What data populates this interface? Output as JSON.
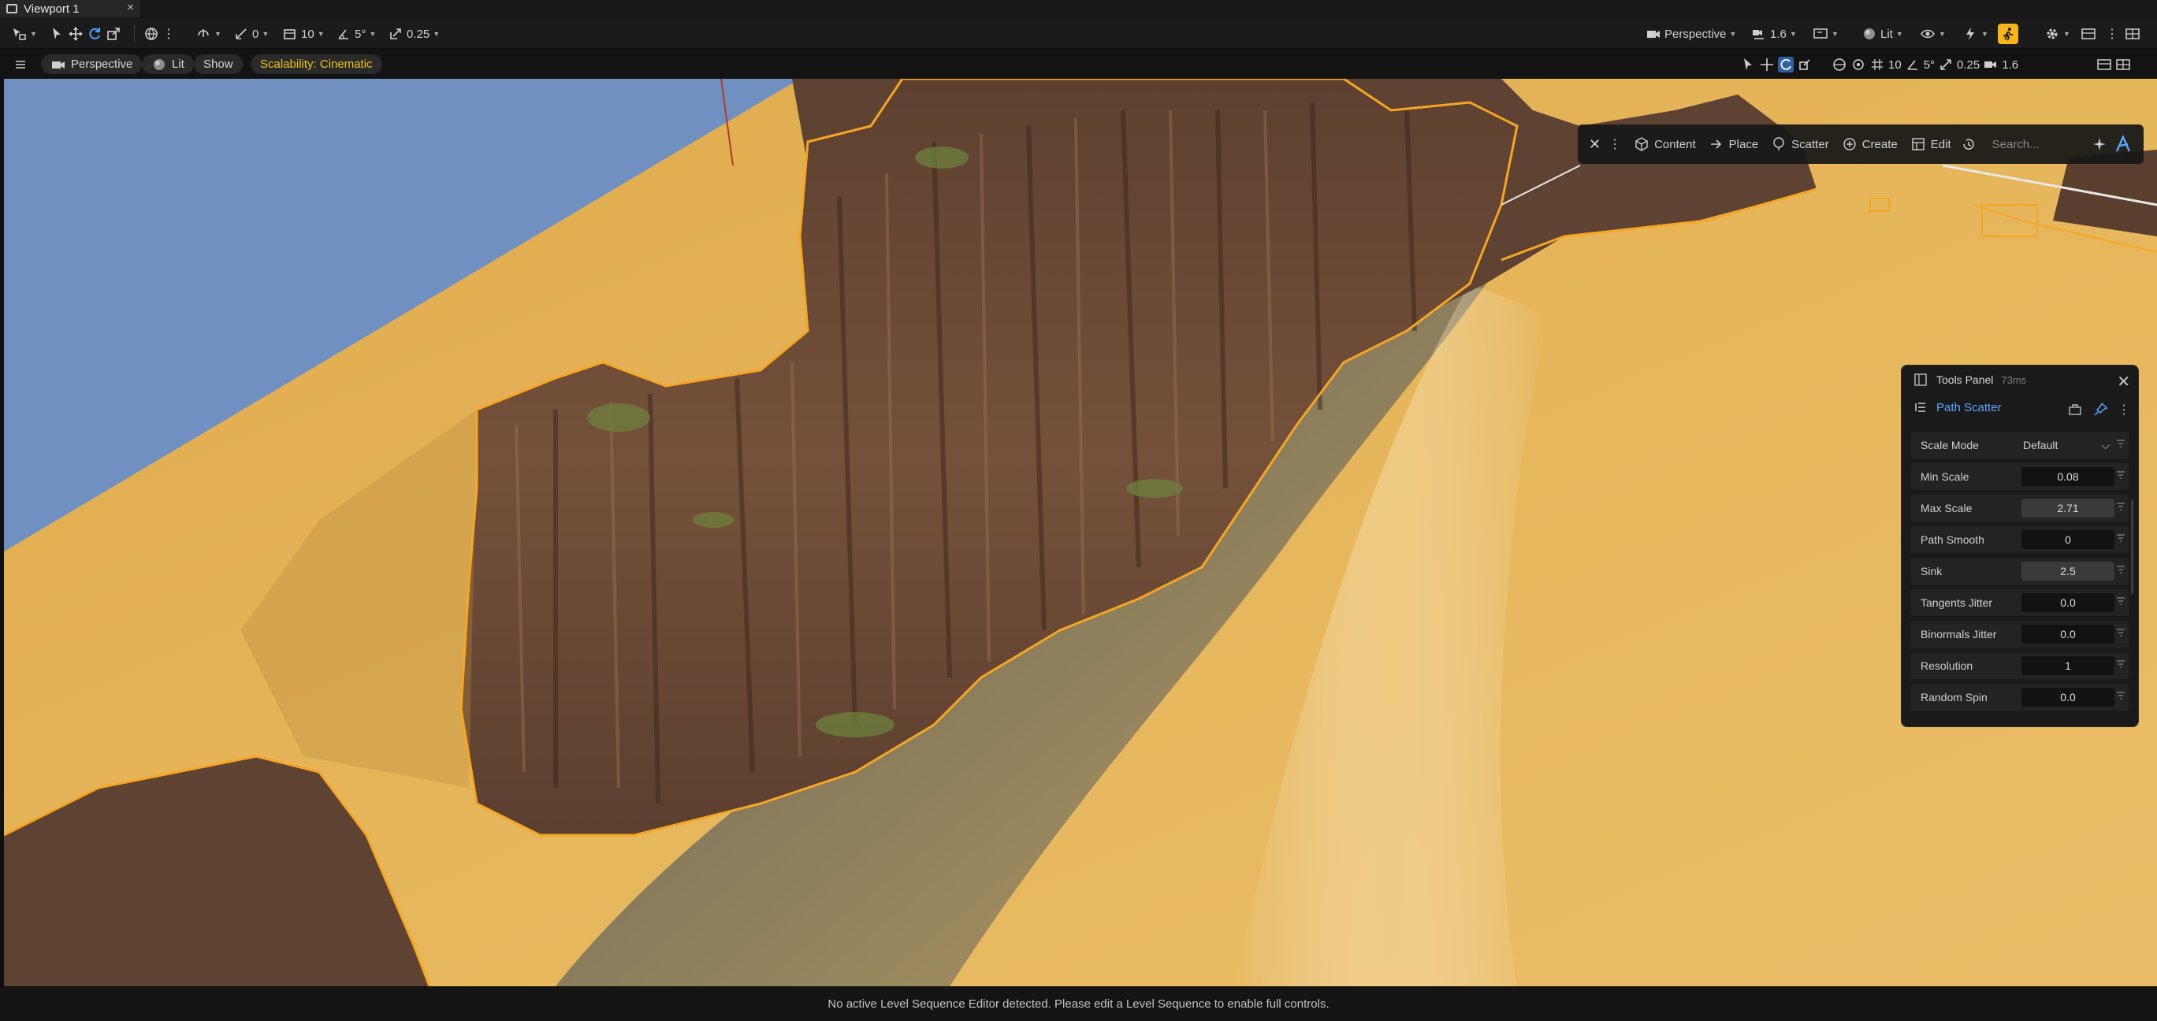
{
  "window": {
    "tab_title": "Viewport 1",
    "close_glyph": "×"
  },
  "toolbar": {
    "rotate_snap": "0",
    "grid_snap": "10",
    "angle_snap": "5°",
    "scale_snap": "0.25",
    "view_mode": "Perspective",
    "camera_speed": "1.6",
    "lit_label": "Lit",
    "accent": "#f5b51b"
  },
  "viewport_bar": {
    "perspective": "Perspective",
    "lit": "Lit",
    "show": "Show",
    "scalability": "Scalability: Cinematic",
    "grid": "10",
    "angle": "5°",
    "scale": "0.25",
    "speed": "1.6"
  },
  "mode_bar": {
    "items": [
      "Content",
      "Place",
      "Scatter",
      "Create",
      "Edit"
    ],
    "search_placeholder": "Search..."
  },
  "tools_panel": {
    "title": "Tools Panel",
    "timing": "73ms",
    "tool_name": "Path Scatter",
    "properties": [
      {
        "label": "Scale Mode",
        "value": "Default",
        "kind": "dropdown"
      },
      {
        "label": "Min Scale",
        "value": "0.08",
        "kind": "number"
      },
      {
        "label": "Max Scale",
        "value": "2.71",
        "kind": "slider"
      },
      {
        "label": "Path Smooth",
        "value": "0",
        "kind": "number"
      },
      {
        "label": "Sink",
        "value": "2.5",
        "kind": "slider"
      },
      {
        "label": "Tangents Jitter",
        "value": "0.0",
        "kind": "number"
      },
      {
        "label": "Binormals Jitter",
        "value": "0.0",
        "kind": "number"
      },
      {
        "label": "Resolution",
        "value": "1",
        "kind": "number"
      },
      {
        "label": "Random Spin",
        "value": "0.0",
        "kind": "number"
      }
    ]
  },
  "status": {
    "message": "No active Level Sequence Editor detected. Please edit a Level Sequence to enable full controls."
  },
  "colors": {
    "sand": "#e4b152",
    "sky": "#6f90c0",
    "cliff": "#6b4a35",
    "water": "#8d8060",
    "selection": "#f5a623",
    "link_blue": "#5aa6ff"
  }
}
